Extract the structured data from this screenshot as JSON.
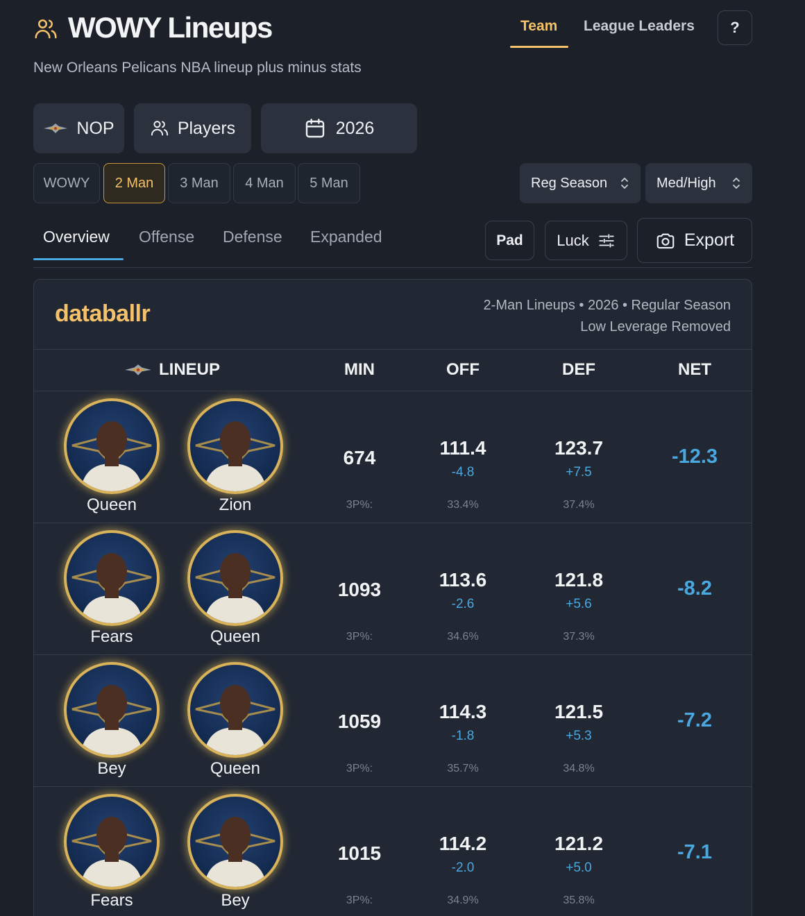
{
  "header": {
    "title": "WOWY Lineups",
    "subtitle": "New Orleans Pelicans NBA lineup plus minus stats",
    "tabs": [
      {
        "label": "Team"
      },
      {
        "label": "League Leaders"
      }
    ],
    "help_label": "?"
  },
  "selectors": {
    "team": "NOP",
    "mode": "Players",
    "season": "2026"
  },
  "man_tabs": [
    "WOWY",
    "2 Man",
    "3 Man",
    "4 Man",
    "5 Man"
  ],
  "dropdowns": {
    "season_type": "Reg Season",
    "leverage": "Med/High"
  },
  "sub_tabs": [
    "Overview",
    "Offense",
    "Defense",
    "Expanded"
  ],
  "actions": {
    "pad": "Pad",
    "luck": "Luck",
    "export": "Export"
  },
  "panel": {
    "brand": "databallr",
    "meta_line1": "2-Man Lineups • 2026 • Regular Season",
    "meta_line2": "Low Leverage Removed",
    "columns": {
      "lineup": "LINEUP",
      "min": "MIN",
      "off": "OFF",
      "def": "DEF",
      "net": "NET"
    }
  },
  "rows": [
    {
      "p1": "Queen",
      "p2": "Zion",
      "min": "674",
      "min_sub": "3P%:",
      "off": "111.4",
      "off_delta": "-4.8",
      "off_sub": "33.4%",
      "def": "123.7",
      "def_delta": "+7.5",
      "def_sub": "37.4%",
      "net": "-12.3"
    },
    {
      "p1": "Fears",
      "p2": "Queen",
      "min": "1093",
      "min_sub": "3P%:",
      "off": "113.6",
      "off_delta": "-2.6",
      "off_sub": "34.6%",
      "def": "121.8",
      "def_delta": "+5.6",
      "def_sub": "37.3%",
      "net": "-8.2"
    },
    {
      "p1": "Bey",
      "p2": "Queen",
      "min": "1059",
      "min_sub": "3P%:",
      "off": "114.3",
      "off_delta": "-1.8",
      "off_sub": "35.7%",
      "def": "121.5",
      "def_delta": "+5.3",
      "def_sub": "34.8%",
      "net": "-7.2"
    },
    {
      "p1": "Fears",
      "p2": "Bey",
      "min": "1015",
      "min_sub": "3P%:",
      "off": "114.2",
      "off_delta": "-2.0",
      "off_sub": "34.9%",
      "def": "121.2",
      "def_delta": "+5.0",
      "def_sub": "35.8%",
      "net": "-7.1"
    }
  ],
  "colors": {
    "accent_gold": "#f5c26b",
    "accent_blue": "#4aa8e0",
    "background": "#1b2029",
    "panel": "#222833"
  }
}
